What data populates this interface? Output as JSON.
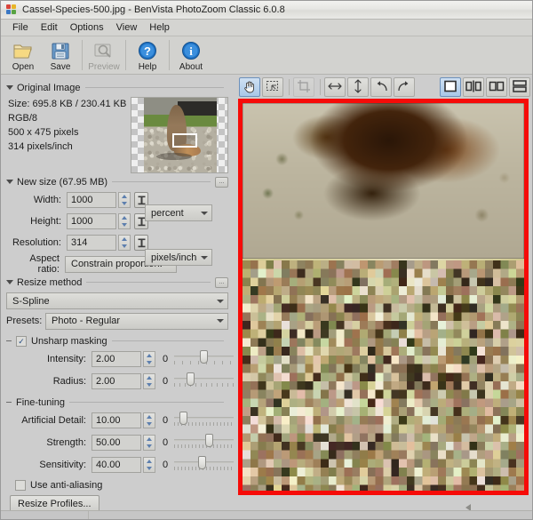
{
  "window": {
    "title": "Cassel-Species-500.jpg - BenVista PhotoZoom Classic 6.0.8",
    "app_icon": "app-logo-icon"
  },
  "menubar": {
    "items": [
      {
        "label": "File"
      },
      {
        "label": "Edit"
      },
      {
        "label": "Options"
      },
      {
        "label": "View"
      },
      {
        "label": "Help"
      }
    ]
  },
  "toolbar": {
    "buttons": [
      {
        "label": "Open",
        "icon": "open-folder-icon",
        "enabled": true
      },
      {
        "label": "Save",
        "icon": "save-floppy-icon",
        "enabled": true
      },
      {
        "label": "Preview",
        "icon": "preview-icon",
        "enabled": false
      },
      {
        "label": "Help",
        "icon": "help-question-icon",
        "enabled": true
      },
      {
        "label": "About",
        "icon": "about-info-icon",
        "enabled": true
      }
    ]
  },
  "original_image": {
    "section_title": "Original Image",
    "size": "Size: 695.8 KB / 230.41 KB",
    "color_mode": "RGB/8",
    "dimensions": "500 x 475 pixels",
    "resolution": "314 pixels/inch",
    "thumbnail_alt": "chipmunk-thumbnail"
  },
  "new_size": {
    "section_title": "New size (67.95 MB)",
    "options_button": "...",
    "width": {
      "label": "Width:",
      "value": "1000"
    },
    "height": {
      "label": "Height:",
      "value": "1000"
    },
    "resolution": {
      "label": "Resolution:",
      "value": "314"
    },
    "size_unit": {
      "value": "percent"
    },
    "resolution_unit": {
      "value": "pixels/inch"
    },
    "aspect_ratio": {
      "label": "Aspect ratio:",
      "value": "Constrain proportions"
    }
  },
  "resize_method": {
    "section_title": "Resize method",
    "options_button": "...",
    "method": {
      "value": "S-Spline"
    },
    "presets": {
      "label": "Presets:",
      "value": "Photo - Regular"
    }
  },
  "unsharp_masking": {
    "section_title": "Unsharp masking",
    "checked": true,
    "check_glyph": "✓",
    "intensity": {
      "label": "Intensity:",
      "value": "2.00",
      "min": "0",
      "max": "5",
      "percent": 40
    },
    "radius": {
      "label": "Radius:",
      "value": "2.00",
      "min": "0",
      "max": "10",
      "percent": 20
    }
  },
  "fine_tuning": {
    "section_title": "Fine-tuning",
    "artificial_detail": {
      "label": "Artificial Detail:",
      "value": "10.00",
      "min": "0",
      "max": "100",
      "percent": 10
    },
    "strength": {
      "label": "Strength:",
      "value": "50.00",
      "min": "0",
      "max": "100",
      "percent": 50
    },
    "sensitivity": {
      "label": "Sensitivity:",
      "value": "40.00",
      "min": "0",
      "max": "100",
      "percent": 40
    }
  },
  "antialiasing": {
    "label": "Use anti-aliasing",
    "checked": false
  },
  "resize_profiles_button": {
    "label": "Resize Profiles..."
  },
  "preview": {
    "tools": [
      {
        "name": "hand-tool",
        "icon": "hand-icon",
        "active": true,
        "enabled": true
      },
      {
        "name": "marquee-select-tool",
        "icon": "marquee-select-icon",
        "active": false,
        "enabled": true
      },
      {
        "name": "crop-tool",
        "icon": "crop-icon",
        "active": false,
        "enabled": false
      },
      {
        "name": "flip-horizontal",
        "icon": "flip-horizontal-icon",
        "active": false,
        "enabled": true
      },
      {
        "name": "flip-vertical",
        "icon": "flip-vertical-icon",
        "active": false,
        "enabled": true
      },
      {
        "name": "rotate-left",
        "icon": "rotate-counterclockwise-icon",
        "active": false,
        "enabled": true
      },
      {
        "name": "rotate-right",
        "icon": "rotate-clockwise-icon",
        "active": false,
        "enabled": true
      }
    ],
    "view_modes": [
      {
        "name": "view-single",
        "icon": "single-pane-icon",
        "active": true
      },
      {
        "name": "view-split",
        "icon": "split-pane-icon",
        "active": false
      },
      {
        "name": "view-side-by-side",
        "icon": "side-by-side-panes-icon",
        "active": false
      },
      {
        "name": "view-stacked",
        "icon": "stacked-panes-icon",
        "active": false
      }
    ],
    "border_color": "#f60b08",
    "scroll_arrow": "scroll-left-arrow-icon"
  }
}
